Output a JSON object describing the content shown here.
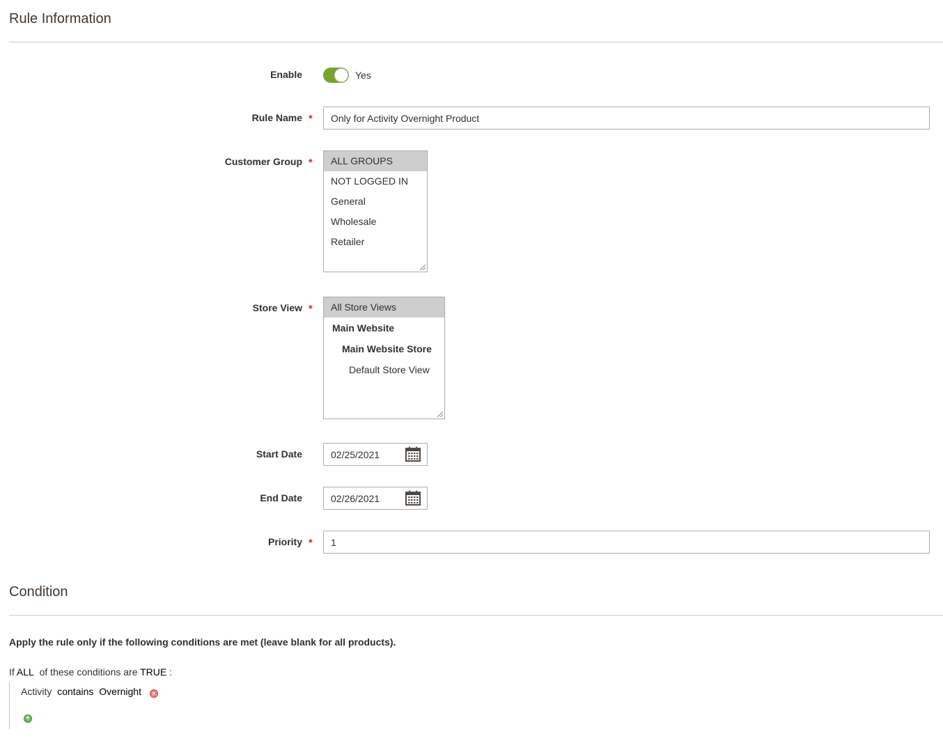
{
  "rule_info": {
    "title": "Rule Information",
    "enable": {
      "label": "Enable",
      "value_text": "Yes",
      "on": true
    },
    "rule_name": {
      "label": "Rule Name",
      "value": "Only for Activity Overnight Product"
    },
    "customer_group": {
      "label": "Customer Group",
      "options": [
        "ALL GROUPS",
        "NOT LOGGED IN",
        "General",
        "Wholesale",
        "Retailer"
      ],
      "selected": "ALL GROUPS"
    },
    "store_view": {
      "label": "Store View",
      "options": [
        "All Store Views",
        "Main Website",
        "Main Website Store",
        "Default Store View"
      ],
      "selected": "All Store Views"
    },
    "start_date": {
      "label": "Start Date",
      "value": "02/25/2021"
    },
    "end_date": {
      "label": "End Date",
      "value": "02/26/2021"
    },
    "priority": {
      "label": "Priority",
      "value": "1"
    },
    "required_mark": "*"
  },
  "condition": {
    "title": "Condition",
    "intro": "Apply the rule only if the following conditions are met (leave blank for all products).",
    "line": {
      "prefix": "If",
      "aggregator": "ALL",
      "middle": "of these conditions are",
      "value": "TRUE",
      "suffix": ":"
    },
    "items": [
      {
        "attribute": "Activity",
        "operator": "contains",
        "value": "Overnight"
      }
    ]
  },
  "colors": {
    "toggle_on": "#79a22e",
    "required": "#e22626",
    "selected_option": "#cecece"
  },
  "icons": {
    "calendar": "calendar-icon",
    "remove": "remove-condition-icon",
    "add": "add-condition-icon"
  }
}
